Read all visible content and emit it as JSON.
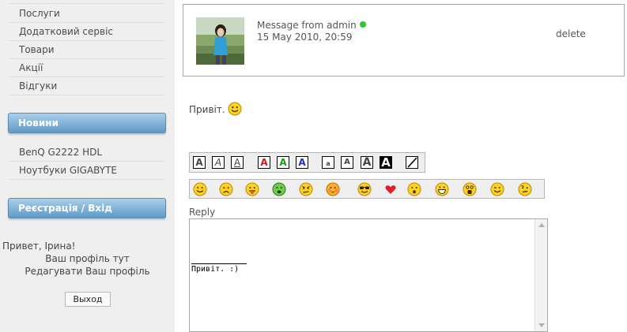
{
  "sidebar": {
    "menu": [
      {
        "label": "Послуги"
      },
      {
        "label": "Додатковий сервіс"
      },
      {
        "label": "Товари"
      },
      {
        "label": "Акції"
      },
      {
        "label": "Відгуки"
      }
    ],
    "news": {
      "heading": "Новини",
      "items": [
        {
          "label": "BenQ G2222 HDL"
        },
        {
          "label": "Ноутбуки GIGABYTE"
        }
      ]
    },
    "account": {
      "heading": "Реєстрація / Вхід",
      "greeting": "Привет, Ірина!",
      "profile_link": "Ваш профіль тут",
      "edit_profile_link": "Редагувати Ваш профіль",
      "logout_label": "Выход"
    }
  },
  "message": {
    "from": "Message from admin",
    "date": "15 May 2010, 20:59",
    "delete_label": "delete",
    "body": "Привіт.",
    "online_color": "#2ec62e"
  },
  "format_toolbar": {
    "buttons": [
      {
        "icon": "bold-icon",
        "glyph": "A"
      },
      {
        "icon": "italic-icon",
        "glyph": "A"
      },
      {
        "icon": "underline-icon",
        "glyph": "A"
      },
      {
        "icon": "red-text-icon",
        "glyph": "A",
        "color": "#e01010"
      },
      {
        "icon": "green-text-icon",
        "glyph": "A",
        "color": "#10a010"
      },
      {
        "icon": "blue-text-icon",
        "glyph": "A",
        "color": "#1030d0"
      },
      {
        "icon": "small-text-icon",
        "glyph": "a"
      },
      {
        "icon": "normal-text-icon",
        "glyph": "A"
      },
      {
        "icon": "large-text-icon",
        "glyph": "A"
      },
      {
        "icon": "huge-text-icon",
        "glyph": "A"
      },
      {
        "icon": "strikethrough-icon",
        "glyph": ""
      }
    ]
  },
  "smiley_toolbar": {
    "buttons": [
      {
        "icon": "smile-icon"
      },
      {
        "icon": "sad-icon"
      },
      {
        "icon": "tongue-icon"
      },
      {
        "icon": "sick-icon"
      },
      {
        "icon": "angry-icon"
      },
      {
        "icon": "blush-icon"
      },
      {
        "icon": "cool-icon"
      },
      {
        "icon": "heart-icon"
      },
      {
        "icon": "surprised-icon"
      },
      {
        "icon": "grin-icon"
      },
      {
        "icon": "shocked-icon"
      },
      {
        "icon": "wink-icon"
      },
      {
        "icon": "confused-icon"
      }
    ]
  },
  "reply": {
    "label": "Reply",
    "content": "Привіт. :)"
  }
}
